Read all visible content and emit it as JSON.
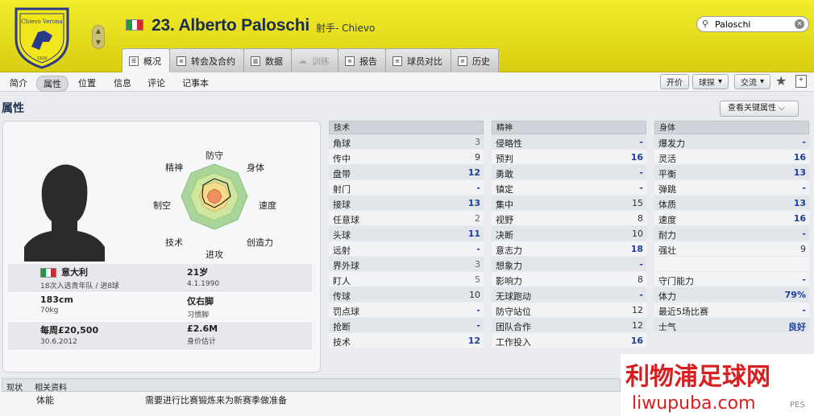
{
  "header": {
    "club_crest_label": "Chievo Verona",
    "club_crest_year": "1929",
    "player_name": "23. Alberto Paloschi",
    "player_role": "射手- Chievo",
    "flag_colors": [
      "#1b9a3e",
      "#ffffff",
      "#d7272e"
    ],
    "search_value": "Paloschi"
  },
  "tabs": [
    {
      "label": "概况"
    },
    {
      "label": "转会及合约"
    },
    {
      "label": "数据"
    },
    {
      "label": "训练"
    },
    {
      "label": "报告"
    },
    {
      "label": "球员对比"
    },
    {
      "label": "历史"
    }
  ],
  "subnav": [
    "简介",
    "属性",
    "位置",
    "信息",
    "评论",
    "记事本"
  ],
  "actions": {
    "offer": "开价",
    "scout": "球探",
    "exchange": "交流"
  },
  "section": {
    "title": "属性",
    "key_attr_button": "查看关键属性"
  },
  "radar": {
    "labels": {
      "defend": "防守",
      "physical": "身体",
      "speed": "速度",
      "creativity": "创造力",
      "attack": "进攻",
      "technique": "技术",
      "aerial": "制空",
      "mental": "精神"
    }
  },
  "profile": {
    "nationality": "意大利",
    "caps": "18次入选青年队 / 进8球",
    "age": "21岁",
    "dob": "4.1.1990",
    "height": "183cm",
    "weight": "70kg",
    "foot": "仅右脚",
    "foot_label": "习惯脚",
    "wage": "每周£20,500",
    "contract": "30.6.2012",
    "value": "£2.6M",
    "value_label": "身价估计"
  },
  "technical": {
    "title": "技术",
    "rows": [
      {
        "n": "角球",
        "v": "3",
        "c": ""
      },
      {
        "n": "传中",
        "v": "9",
        "c": "dark"
      },
      {
        "n": "盘带",
        "v": "12",
        "c": "blue"
      },
      {
        "n": "射门",
        "v": "-",
        "c": "blue"
      },
      {
        "n": "接球",
        "v": "13",
        "c": "blue"
      },
      {
        "n": "任意球",
        "v": "2",
        "c": ""
      },
      {
        "n": "头球",
        "v": "11",
        "c": "blue"
      },
      {
        "n": "远射",
        "v": "-",
        "c": "blue"
      },
      {
        "n": "界外球",
        "v": "3",
        "c": ""
      },
      {
        "n": "盯人",
        "v": "5",
        "c": ""
      },
      {
        "n": "传球",
        "v": "10",
        "c": "dark"
      },
      {
        "n": "罚点球",
        "v": "-",
        "c": "blue"
      },
      {
        "n": "抢断",
        "v": "-",
        "c": "blue"
      },
      {
        "n": "技术",
        "v": "12",
        "c": "blue"
      }
    ]
  },
  "mental": {
    "title": "精神",
    "rows": [
      {
        "n": "侵略性",
        "v": "-",
        "c": "blue"
      },
      {
        "n": "预判",
        "v": "16",
        "c": "blue"
      },
      {
        "n": "勇敢",
        "v": "-",
        "c": "blue"
      },
      {
        "n": "镇定",
        "v": "-",
        "c": "blue"
      },
      {
        "n": "集中",
        "v": "15",
        "c": "dark"
      },
      {
        "n": "视野",
        "v": "8",
        "c": "dark"
      },
      {
        "n": "决断",
        "v": "10",
        "c": "dark"
      },
      {
        "n": "意志力",
        "v": "18",
        "c": "blue"
      },
      {
        "n": "想象力",
        "v": "-",
        "c": "blue"
      },
      {
        "n": "影响力",
        "v": "8",
        "c": "dark"
      },
      {
        "n": "无球跑动",
        "v": "-",
        "c": "blue"
      },
      {
        "n": "防守站位",
        "v": "12",
        "c": "dark"
      },
      {
        "n": "团队合作",
        "v": "12",
        "c": "dark"
      },
      {
        "n": "工作投入",
        "v": "16",
        "c": "blue"
      }
    ]
  },
  "physical": {
    "title": "身体",
    "rows": [
      {
        "n": "爆发力",
        "v": "-",
        "c": "blue"
      },
      {
        "n": "灵活",
        "v": "16",
        "c": "blue"
      },
      {
        "n": "平衡",
        "v": "13",
        "c": "blue"
      },
      {
        "n": "弹跳",
        "v": "-",
        "c": "blue"
      },
      {
        "n": "体质",
        "v": "13",
        "c": "blue"
      },
      {
        "n": "速度",
        "v": "16",
        "c": "blue"
      },
      {
        "n": "耐力",
        "v": "-",
        "c": "blue"
      },
      {
        "n": "强壮",
        "v": "9",
        "c": "dark"
      }
    ],
    "extra": [
      {
        "n": "守门能力",
        "v": "-",
        "c": "blue"
      },
      {
        "n": "体力",
        "v": "79%",
        "c": "blue"
      },
      {
        "n": "最近5场比赛",
        "v": "-",
        "c": "blue"
      },
      {
        "n": "士气",
        "v": "良好",
        "c": "blue"
      }
    ]
  },
  "status": {
    "col1": "现状",
    "col2": "相关资料",
    "row_label": "体能",
    "row_text": "需要进行比赛锻炼来为新赛季做准备"
  },
  "watermark": {
    "cn": "利物浦足球网",
    "en": "liwupuba.com",
    "corner": "PES"
  }
}
